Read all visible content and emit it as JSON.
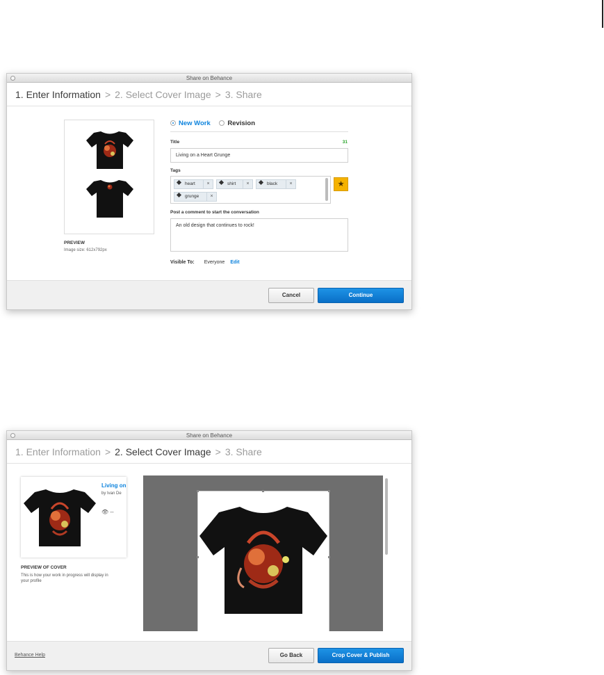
{
  "dialog1": {
    "window_title": "Share on Behance",
    "steps": [
      {
        "label": "1. Enter Information"
      },
      {
        "label": "2. Select Cover Image"
      },
      {
        "label": "3. Share"
      }
    ],
    "step_sep": ">",
    "radio_new": "New Work",
    "radio_revision": "Revision",
    "title_label": "Title",
    "title_count": "31",
    "title_value": "Living on a Heart Grunge",
    "tags_label": "Tags",
    "tags": [
      {
        "label": "heart"
      },
      {
        "label": "shirt"
      },
      {
        "label": "black"
      },
      {
        "label": "grunge"
      }
    ],
    "tag_remove": "×",
    "star_glyph": "★",
    "comment_label": "Post a comment to start the conversation",
    "comment_value": "An old design that continues to rock!",
    "visible_label": "Visible To:",
    "visible_value": "Everyone",
    "edit_label": "Edit",
    "preview_label": "PREVIEW",
    "image_size": "Image size: 612x792px",
    "cancel_label": "Cancel",
    "continue_label": "Continue"
  },
  "dialog2": {
    "window_title": "Share on Behance",
    "card_title": "Living on",
    "card_by": "by Ivan De",
    "card_views": "👁 --",
    "cover_label": "PREVIEW OF COVER",
    "cover_desc": "This is how your work in progress will display in your profile",
    "help_label": "Behance Help",
    "goback_label": "Go Back",
    "crop_label": "Crop Cover & Publish"
  },
  "colors": {
    "accent": "#0d83dd",
    "count_green": "#2aa42a",
    "star_orange": "#f5b200"
  },
  "icons": [
    "tag-icon",
    "remove-tag-icon",
    "star-icon",
    "eye-icon",
    "window-close-icon"
  ]
}
